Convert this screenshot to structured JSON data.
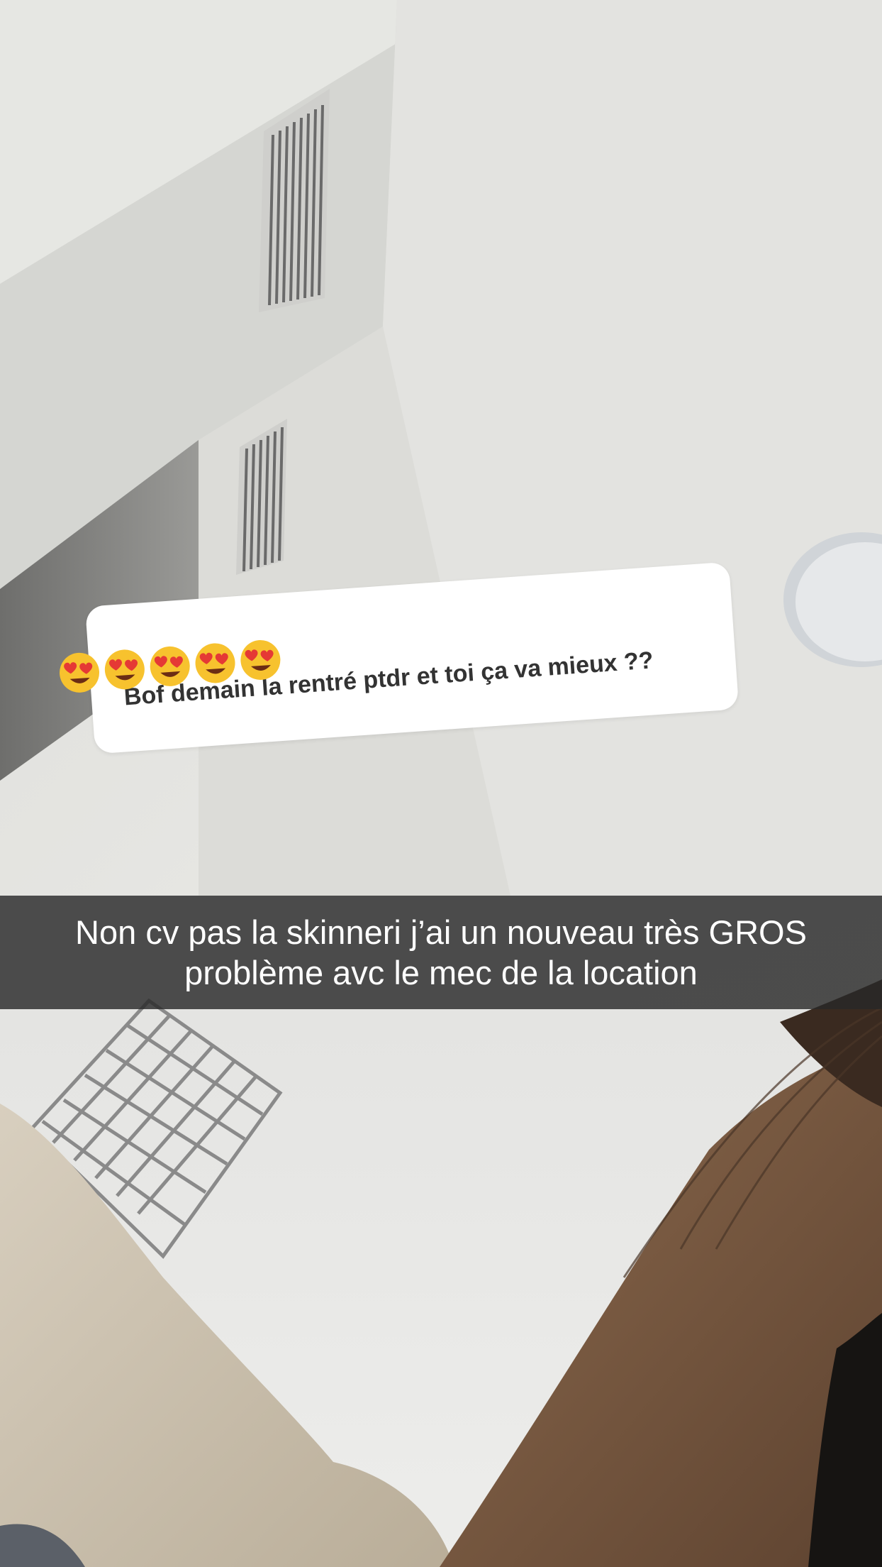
{
  "reply_sticker": {
    "emojis": [
      "heart-eyes-emoji",
      "heart-eyes-emoji",
      "heart-eyes-emoji",
      "heart-eyes-emoji",
      "heart-eyes-emoji"
    ],
    "message": "Bof demain la rentré ptdr et toi ça va mieux ??"
  },
  "caption": {
    "text": "Non cv pas la skinneri j’ai un nouveau très GROS problème avc le mec de la location"
  }
}
